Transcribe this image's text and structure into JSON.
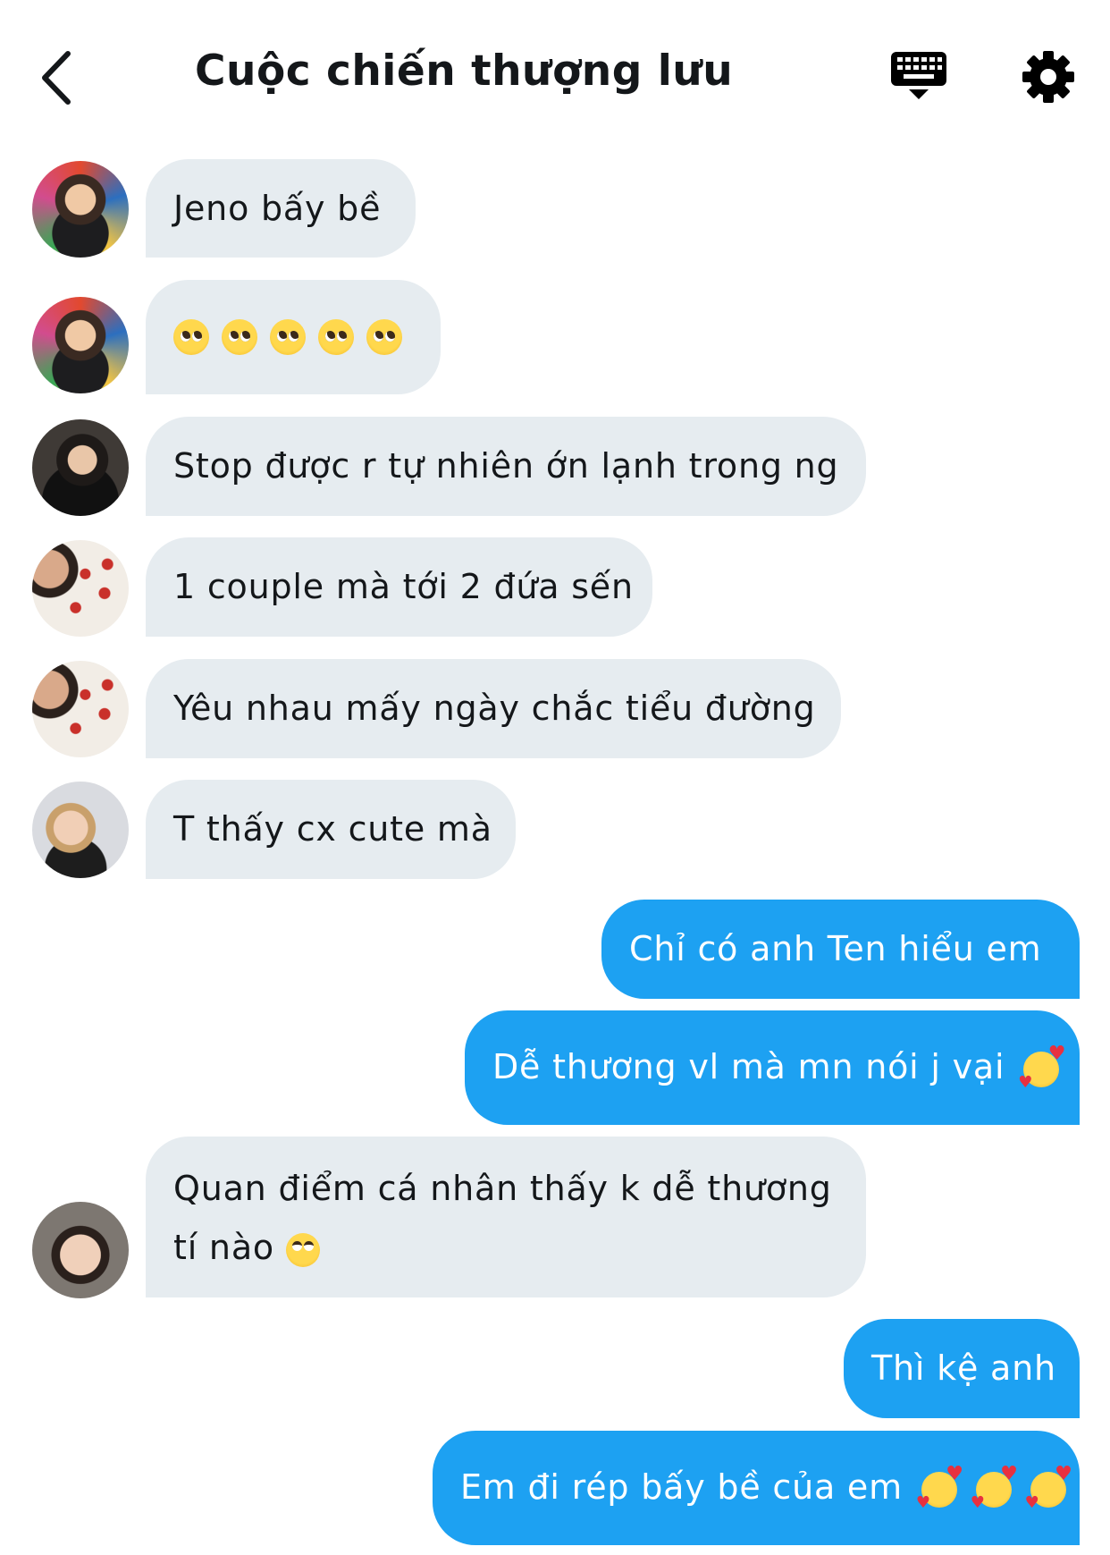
{
  "header": {
    "title": "Cuộc chiến thượng lưu",
    "icons": [
      "back-arrow-icon",
      "keyboard-icon",
      "gear-icon"
    ]
  },
  "messages": [
    {
      "side": "received",
      "avatar": "avatar-1",
      "text": "Jeno bấy bề"
    },
    {
      "side": "received",
      "avatar": "avatar-1",
      "emoji": [
        "pleading-face",
        "pleading-face",
        "pleading-face",
        "pleading-face",
        "pleading-face"
      ]
    },
    {
      "side": "received",
      "avatar": "avatar-2",
      "text": "Stop được r tự nhiên ớn lạnh trong ng"
    },
    {
      "side": "received",
      "avatar": "avatar-3",
      "text": "1 couple mà tới 2 đứa sến"
    },
    {
      "side": "received",
      "avatar": "avatar-3",
      "text": "Yêu nhau mấy ngày chắc tiểu đường"
    },
    {
      "side": "received",
      "avatar": "avatar-4",
      "text": "T thấy cx cute mà"
    },
    {
      "side": "sent",
      "text": "Chỉ có anh Ten hiểu em"
    },
    {
      "side": "sent",
      "text": "Dễ thương vl mà mn nói j vại",
      "emoji": [
        "smiling-face-with-hearts"
      ]
    },
    {
      "side": "received",
      "avatar": "avatar-5",
      "lines": [
        "Quan điểm cá nhân thấy k dễ thương",
        "tí nào"
      ],
      "emoji": [
        "face-with-rolling-eyes"
      ]
    },
    {
      "side": "sent",
      "text": "Thì kệ anh"
    },
    {
      "side": "sent",
      "text": "Em đi rép bấy bề của em",
      "emoji": [
        "smiling-face-with-hearts",
        "smiling-face-with-hearts",
        "smiling-face-with-hearts"
      ]
    }
  ],
  "colors": {
    "sent_bubble": "#1da1f2",
    "received_bubble": "#e6ecf0",
    "text_dark": "#14171a"
  }
}
